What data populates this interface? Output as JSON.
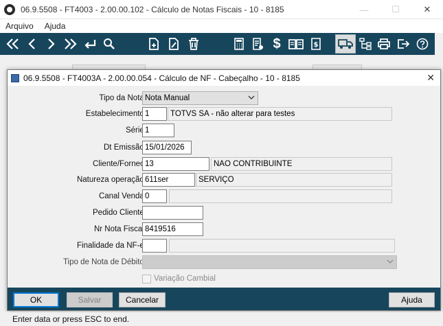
{
  "main_window": {
    "title": "06.9.5508 - FT4003 - 2.00.00.102 - Cálculo de Notas Fiscais - 10 - 8185",
    "controls": {
      "minimize": "—",
      "maximize": "☐",
      "close": "✕"
    },
    "menu": [
      "Arquivo",
      "Ajuda"
    ]
  },
  "toolbar": {
    "icons": [
      "first-icon",
      "previous-icon",
      "next-icon",
      "last-icon",
      "enter-icon",
      "search-icon",
      "new-document-icon",
      "edit-document-icon",
      "delete-icon",
      "calculator-icon",
      "report-icon",
      "dollar-icon",
      "book-icon",
      "invoice-icon",
      "truck-icon",
      "hierarchy-icon",
      "print-icon",
      "exit-icon",
      "help-icon"
    ]
  },
  "dialog": {
    "title": "06.9.5508 - FT4003A - 2.00.00.054 - Cálculo de NF - Cabeçalho - 10 - 8185",
    "close": "✕",
    "fields": {
      "tipo_nota": {
        "label": "Tipo da Nota:",
        "value": "Nota Manual"
      },
      "estabelecimento": {
        "label": "Estabelecimento:",
        "value": "1",
        "description": "TOTVS SA - não alterar para testes"
      },
      "serie": {
        "label": "Série:",
        "value": "1"
      },
      "dt_emissao": {
        "label": "Dt Emissão:",
        "value": "15/01/2026"
      },
      "cliente": {
        "label": "Cliente/Fornec:",
        "value": "13",
        "description": "NAO CONTRIBUINTE"
      },
      "natureza": {
        "label": "Natureza operação:",
        "value": "611ser",
        "description": "SERVIÇO"
      },
      "canal_venda": {
        "label": "Canal Venda:",
        "value": "0",
        "description": ""
      },
      "pedido_cliente": {
        "label": "Pedido Cliente:",
        "value": ""
      },
      "nr_nota": {
        "label": "Nr Nota Fiscal:",
        "value": "8419516"
      },
      "finalidade": {
        "label": "Finalidade da NF-e:",
        "value": "",
        "description": ""
      },
      "tipo_debito": {
        "label": "Tipo de Nota de Débito:",
        "value": ""
      },
      "variacao_cambial": {
        "label": "Variação Cambial",
        "checked": false
      }
    },
    "buttons": {
      "ok": "OK",
      "salvar": "Salvar",
      "cancelar": "Cancelar",
      "ajuda": "Ajuda"
    }
  },
  "status_bar": {
    "text": "Enter data or press ESC to end."
  },
  "colors": {
    "toolbar_bg": "#17465c",
    "focus_border": "#0078d7"
  }
}
